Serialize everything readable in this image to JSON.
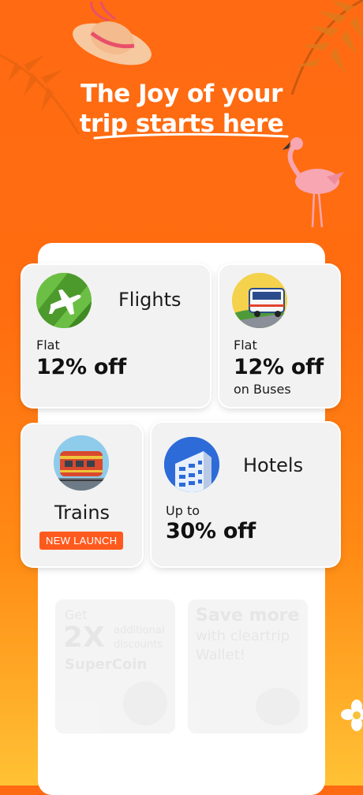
{
  "hero": {
    "headline_line1": "The Joy of your",
    "headline_line2": "trip starts here"
  },
  "cards": {
    "flights": {
      "title": "Flights",
      "line1": "Flat",
      "line2": "12% off",
      "icon": "airplane-icon"
    },
    "buses": {
      "line1": "Flat",
      "line2": "12% off",
      "line3": "on Buses",
      "icon": "bus-icon"
    },
    "trains": {
      "title": "Trains",
      "badge": "NEW LAUNCH",
      "icon": "train-icon"
    },
    "hotels": {
      "title": "Hotels",
      "line1": "Up to",
      "line2": "30% off",
      "icon": "building-icon"
    }
  },
  "promos": {
    "supercoin": {
      "get": "Get",
      "amount": "2X",
      "sub1": "additional",
      "sub2": "discounts",
      "brand": "SuperCoin"
    },
    "wallet": {
      "line1": "Save more",
      "line2": "with cleartrip",
      "line3": "Wallet!"
    }
  },
  "colors": {
    "accent": "#ff6a12",
    "badge": "#ff5a1e",
    "card_bg": "#f2f2f2"
  }
}
